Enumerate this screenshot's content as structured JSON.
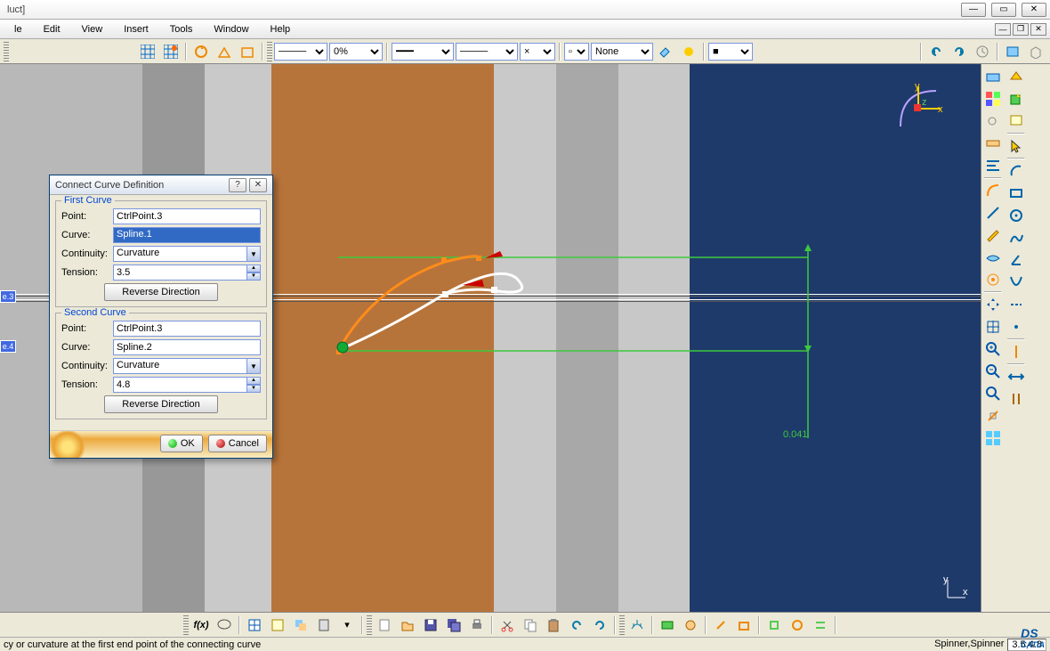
{
  "title_suffix": "luct]",
  "menu": [
    "le",
    "Edit",
    "View",
    "Insert",
    "Tools",
    "Window",
    "Help"
  ],
  "toolbar": {
    "opacity": "0%",
    "layer": "None"
  },
  "dialog": {
    "title": "Connect Curve Definition",
    "first": {
      "legend": "First Curve",
      "point_label": "Point:",
      "point_value": "CtrlPoint.3",
      "curve_label": "Curve:",
      "curve_value": "Spline.1",
      "continuity_label": "Continuity:",
      "continuity_value": "Curvature",
      "tension_label": "Tension:",
      "tension_value": "3.5",
      "reverse_label": "Reverse Direction"
    },
    "second": {
      "legend": "Second Curve",
      "point_label": "Point:",
      "point_value": "CtrlPoint.3",
      "curve_label": "Curve:",
      "curve_value": "Spline.2",
      "continuity_label": "Continuity:",
      "continuity_value": "Curvature",
      "tension_label": "Tension:",
      "tension_value": "4.8",
      "reverse_label": "Reverse Direction"
    },
    "ok": "OK",
    "cancel": "Cancel"
  },
  "viewport": {
    "dim_value": "0.041",
    "axis_x": "x",
    "axis_y": "y",
    "axis_z": "z",
    "tree1": "e.3",
    "tree2": "e.4"
  },
  "status": {
    "left": "cy or curvature at the first end point of the connecting curve",
    "spinner_label": "Spinner,Spinner",
    "spinner_value": "3.5,4.8"
  },
  "logo": "CATIA"
}
